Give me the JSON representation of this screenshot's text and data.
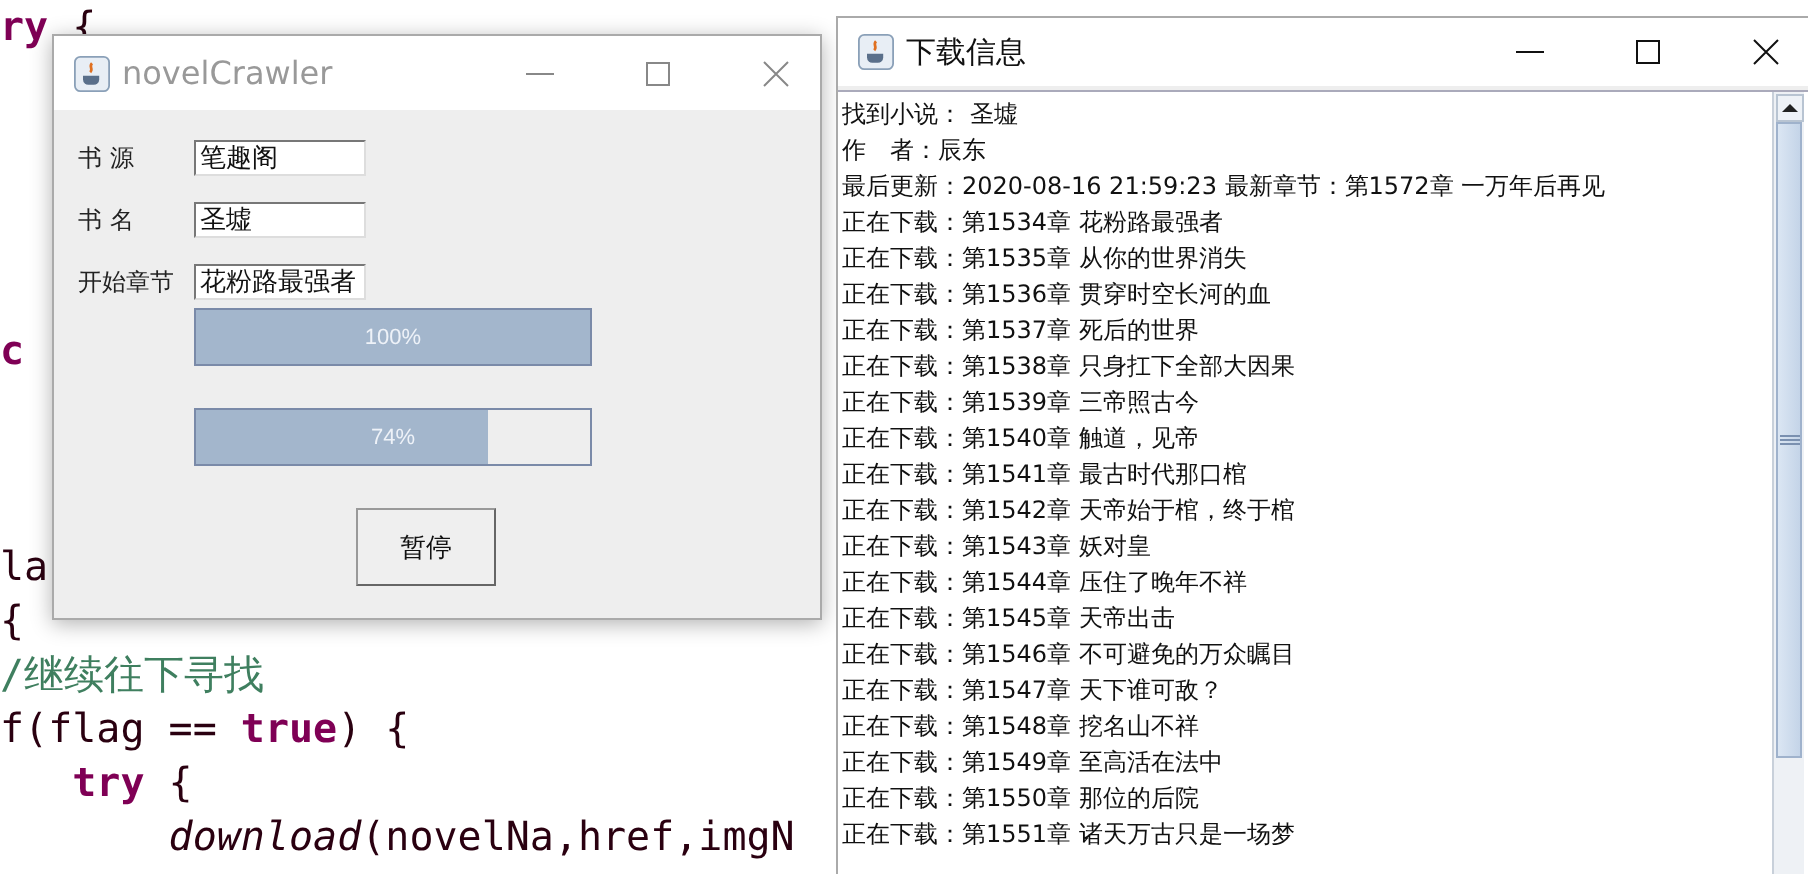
{
  "code_editor": {
    "lines": [
      {
        "kind": "code",
        "segments": [
          {
            "text": "ry",
            "kind": "keyword"
          },
          {
            "text": " {",
            "kind": "plain"
          }
        ]
      },
      {
        "kind": "blank"
      },
      {
        "kind": "blank"
      },
      {
        "kind": "blank"
      },
      {
        "kind": "blank"
      },
      {
        "kind": "blank"
      },
      {
        "kind": "code",
        "segments": [
          {
            "text": "c",
            "kind": "keyword"
          }
        ]
      },
      {
        "kind": "blank"
      },
      {
        "kind": "blank"
      },
      {
        "kind": "blank"
      },
      {
        "kind": "code",
        "segments": [
          {
            "text": "la",
            "kind": "plain"
          }
        ]
      },
      {
        "kind": "code",
        "segments": [
          {
            "text": "{",
            "kind": "plain"
          }
        ]
      },
      {
        "kind": "code",
        "segments": [
          {
            "text": "/继续往下寻找",
            "kind": "comment"
          }
        ]
      },
      {
        "kind": "code",
        "segments": [
          {
            "text": "f(flag == ",
            "kind": "plain"
          },
          {
            "text": "true",
            "kind": "keyword"
          },
          {
            "text": ") {",
            "kind": "plain"
          }
        ],
        "children": [
          {
            "kind": "code",
            "segments": [
              {
                "text": "try",
                "kind": "keyword"
              },
              {
                "text": " {",
                "kind": "plain"
              }
            ],
            "children": [
              {
                "kind": "code",
                "segments": [
                  {
                    "text": "download",
                    "kind": "call"
                  },
                  {
                    "text": "(novelNa,href,imgN",
                    "kind": "plain"
                  }
                ]
              }
            ]
          }
        ]
      }
    ]
  },
  "crawler_window": {
    "title": "novelCrawler",
    "active": false,
    "fields": [
      {
        "label": "书 源",
        "value": "笔趣阁"
      },
      {
        "label": "书 名",
        "value": "圣墟"
      },
      {
        "label": "开始章节",
        "value": "花粉路最强者"
      }
    ],
    "progress": [
      {
        "level": 1,
        "reading": "100%"
      },
      {
        "level": 0.74,
        "reading": "74%"
      }
    ],
    "button": "暂停"
  },
  "download_window": {
    "title": "下载信息",
    "active": true,
    "lines": [
      "找到小说： 圣墟",
      "作　者：辰东",
      "最后更新：2020-08-16 21:59:23 最新章节：第1572章 一万年后再见",
      "正在下载：第1534章 花粉路最强者",
      "正在下载：第1535章 从你的世界消失",
      "正在下载：第1536章 贯穿时空长河的血",
      "正在下载：第1537章 死后的世界",
      "正在下载：第1538章 只身扛下全部大因果",
      "正在下载：第1539章 三帝照古今",
      "正在下载：第1540章 触道，见帝",
      "正在下载：第1541章 最古时代那口棺",
      "正在下载：第1542章 天帝始于棺，终于棺",
      "正在下载：第1543章 妖对皇",
      "正在下载：第1544章 压住了晚年不祥",
      "正在下载：第1545章 天帝出击",
      "正在下载：第1546章 不可避免的万众瞩目",
      "正在下载：第1547章 天下谁可敌？",
      "正在下载：第1548章 挖名山不祥",
      "正在下载：第1549章 至高活在法中",
      "正在下载：第1550章 那位的后院",
      "正在下载：第1551章 诸天万古只是一场梦"
    ]
  }
}
